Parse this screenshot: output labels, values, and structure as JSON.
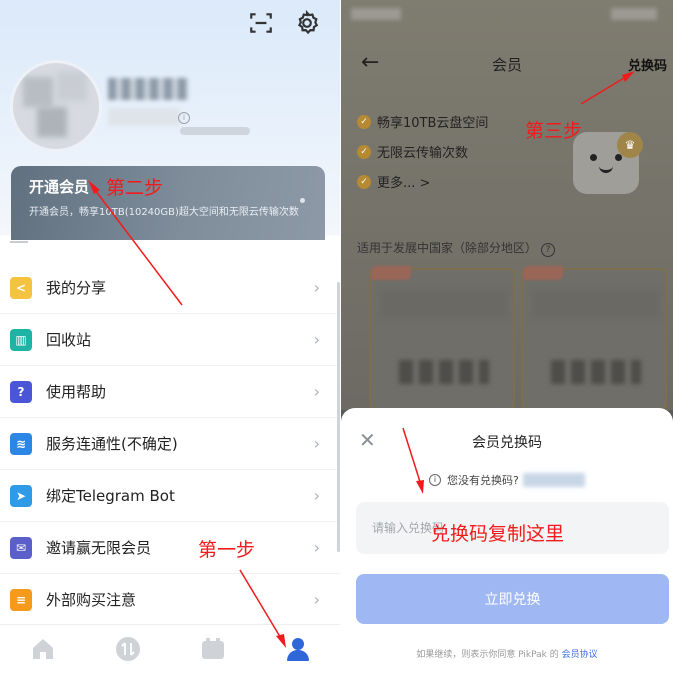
{
  "left": {
    "vip_card": {
      "title": "开通会员",
      "desc": "开通会员，畅享10TB(10240GB)超大空间和无限云传输次数"
    },
    "menu": [
      {
        "label": "我的分享",
        "icon": "share-icon",
        "color": "#f5c342",
        "glyph": "<"
      },
      {
        "label": "回收站",
        "icon": "trash-icon",
        "color": "#1fb3a6",
        "glyph": "🗑"
      },
      {
        "label": "使用帮助",
        "icon": "help-icon",
        "color": "#4a56d6",
        "glyph": "?"
      },
      {
        "label": "服务连通性(不确定)",
        "icon": "wifi-icon",
        "color": "#2b86e6",
        "glyph": "≋"
      },
      {
        "label": "绑定Telegram Bot",
        "icon": "telegram-icon",
        "color": "#2f9ae6",
        "glyph": "➤"
      },
      {
        "label": "邀请赢无限会员",
        "icon": "mail-icon",
        "color": "#5a5fc9",
        "glyph": "✉"
      },
      {
        "label": "外部购买注意",
        "icon": "message-icon",
        "color": "#f59a1b",
        "glyph": "≡"
      }
    ],
    "annotations": {
      "step1": "第一步",
      "step2": "第二步"
    }
  },
  "right": {
    "header": {
      "title": "会员",
      "redeem_link": "兑换码"
    },
    "perks": [
      "畅享10TB云盘空间",
      "无限云传输次数",
      "更多... >"
    ],
    "region": "适用于发展中国家（除部分地区）",
    "sheet": {
      "title": "会员兑换码",
      "no_code": "您没有兑换码?",
      "input_placeholder": "请输入兑换码",
      "button": "立即兑换",
      "agree_prefix": "如果继续，则表示你同意 PikPak 的",
      "agree_link": "会员协议"
    },
    "annotations": {
      "step3": "第三步",
      "paste_here": "兑换码复制这里"
    }
  },
  "colors": {
    "annotation_red": "#f21b1b",
    "button_blue": "#9fb8f3",
    "link_blue": "#3d6fe0",
    "check_gold": "#b58a32"
  }
}
